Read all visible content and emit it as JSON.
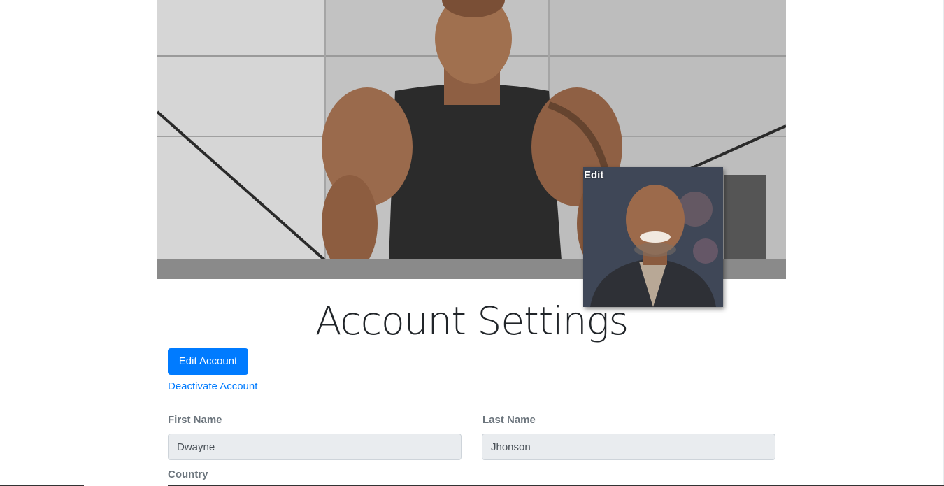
{
  "cover": {
    "description_icon": "cover-photo"
  },
  "avatar": {
    "edit_label": "Edit",
    "icon": "profile-photo"
  },
  "header": {
    "title": "Account Settings"
  },
  "actions": {
    "edit_account_label": "Edit Account",
    "deactivate_label": "Deactivate Account"
  },
  "form": {
    "first_name": {
      "label": "First Name",
      "value": "Dwayne"
    },
    "last_name": {
      "label": "Last Name",
      "value": "Jhonson"
    },
    "country": {
      "label": "Country"
    }
  },
  "colors": {
    "primary": "#007bff",
    "input_bg": "#e9ecef",
    "label": "#6c757d"
  }
}
